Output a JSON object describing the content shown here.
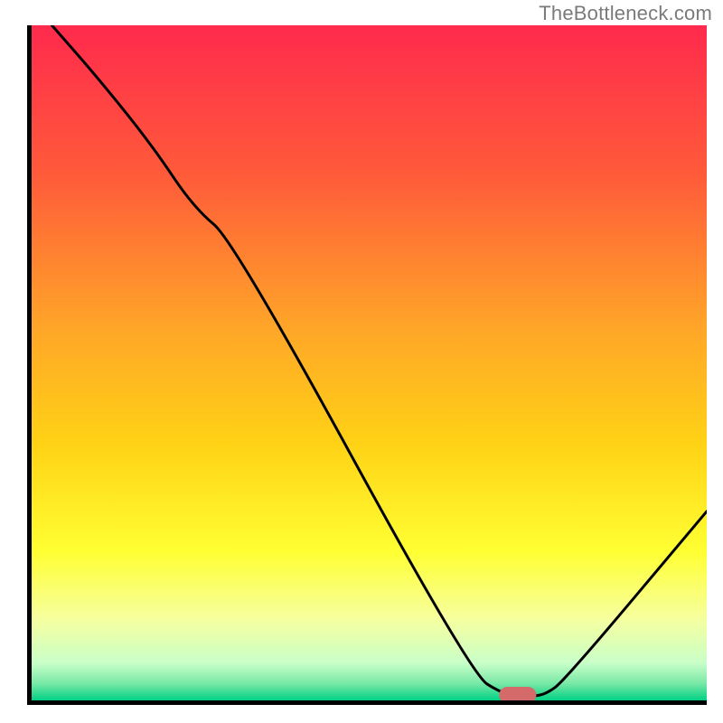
{
  "watermark": "TheBottleneck.com",
  "chart_data": {
    "type": "line",
    "title": "",
    "xlabel": "",
    "ylabel": "",
    "xlim": [
      0,
      100
    ],
    "ylim": [
      0,
      100
    ],
    "grid": false,
    "legend": false,
    "background_gradient_stops": [
      {
        "offset": 0.0,
        "color": "#ff2a4d"
      },
      {
        "offset": 0.22,
        "color": "#ff5a3a"
      },
      {
        "offset": 0.45,
        "color": "#ffa628"
      },
      {
        "offset": 0.62,
        "color": "#ffd215"
      },
      {
        "offset": 0.78,
        "color": "#ffff33"
      },
      {
        "offset": 0.88,
        "color": "#f6ffa0"
      },
      {
        "offset": 0.945,
        "color": "#c8ffc8"
      },
      {
        "offset": 0.975,
        "color": "#78e8a6"
      },
      {
        "offset": 1.0,
        "color": "#00d184"
      }
    ],
    "series": [
      {
        "name": "bottleneck-curve",
        "stroke": "#000000",
        "stroke_width": 3,
        "x": [
          3,
          10,
          18,
          24,
          30,
          65,
          70,
          73.5,
          76,
          79,
          100
        ],
        "y": [
          100,
          92,
          82,
          73,
          68,
          4,
          0.8,
          0.6,
          0.8,
          3,
          28
        ]
      }
    ],
    "marker": {
      "name": "target-marker",
      "shape": "pill",
      "x": 72,
      "y": 0.8,
      "width_pct": 5.5,
      "height_pct": 2.4,
      "fill": "#d46a6a"
    }
  }
}
